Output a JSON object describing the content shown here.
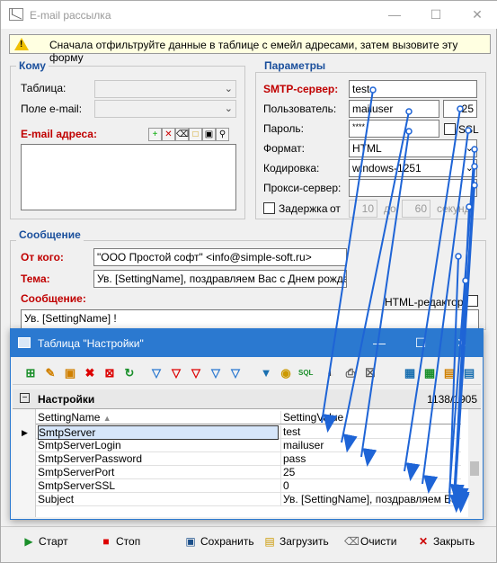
{
  "window": {
    "title": "E-mail рассылка",
    "info": "Сначала отфильтруйте данные в таблице с емейл адресами, затем вызовите эту форму"
  },
  "komu": {
    "legend": "Кому",
    "table_label": "Таблица:",
    "field_label": "Поле e-mail:",
    "addresses_label": "E-mail адреса:"
  },
  "params": {
    "legend": "Параметры",
    "smtp_label": "SMTP-сервер:",
    "smtp_value": "test",
    "user_label": "Пользователь:",
    "user_value": "mailuser",
    "port_value": "25",
    "pass_label": "Пароль:",
    "pass_value": "****",
    "ssl_label": "SSL",
    "format_label": "Формат:",
    "format_value": "HTML",
    "encoding_label": "Кодировка:",
    "encoding_value": "windows-1251",
    "proxy_label": "Прокси-сервер:",
    "delay_label": "Задержка",
    "from_label": "от",
    "from_value": "10",
    "to_label": "до",
    "to_value": "60",
    "unit_label": "секунд"
  },
  "message": {
    "legend": "Сообщение",
    "from_label": "От кого:",
    "from_value": "\"ООО Простой софт\" <info@simple-soft.ru>",
    "subject_label": "Тема:",
    "subject_value": "Ув. [SettingName], поздравляем Вас с Днем рождения",
    "body_label": "Сообщение:",
    "html_editor_label": "HTML-редактор",
    "body_value": "Ув. [SettingName] !"
  },
  "popup": {
    "title": "Таблица \"Настройки\"",
    "grid_title": "Настройки",
    "counter": "1138/1905",
    "col1": "SettingName",
    "col2": "SettingValue",
    "rows": [
      {
        "name": "SmtpServer",
        "value": "test"
      },
      {
        "name": "SmtpServerLogin",
        "value": "mailuser"
      },
      {
        "name": "SmtpServerPassword",
        "value": "pass"
      },
      {
        "name": "SmtpServerPort",
        "value": "25"
      },
      {
        "name": "SmtpServerSSL",
        "value": "0"
      },
      {
        "name": "Subject",
        "value": "Ув. [SettingName], поздравляем Вас с"
      }
    ]
  },
  "bottom": {
    "start": "Старт",
    "stop": "Стоп",
    "save": "Сохранить",
    "load": "Загрузить",
    "clear": "Очисти",
    "close": "Закрыть"
  },
  "colors": {
    "accent": "#2b79d0",
    "label_red": "#c00000",
    "label_blue": "#1a4f9c"
  }
}
